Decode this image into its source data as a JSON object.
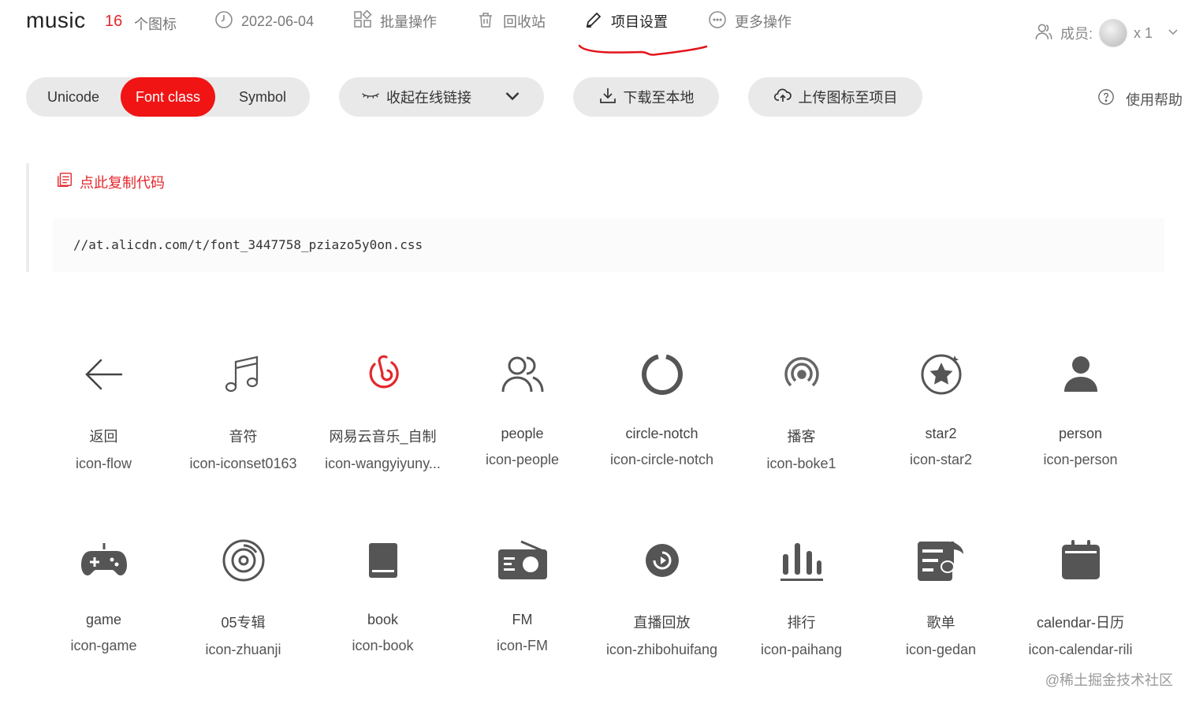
{
  "header": {
    "project_name": "music",
    "icon_count": "16",
    "icon_count_label": "个图标",
    "date": "2022-06-04",
    "batch_ops": "批量操作",
    "recycle_bin": "回收站",
    "project_settings": "项目设置",
    "more_ops": "更多操作",
    "members_label": "成员:",
    "members_count": "x 1",
    "accent_color": "#e4272c"
  },
  "toolbar": {
    "tabs": [
      "Unicode",
      "Font class",
      "Symbol"
    ],
    "active_tab": "Font class",
    "collapse_link": "收起在线链接",
    "download": "下载至本地",
    "upload": "上传图标至项目",
    "help": "使用帮助"
  },
  "code": {
    "copy_label": "点此复制代码",
    "url": "//at.alicdn.com/t/font_3447758_pziazo5y0on.css"
  },
  "icons": [
    {
      "title": "返回",
      "class_name": "icon-flow",
      "icon": "arrow-left-icon"
    },
    {
      "title": "音符",
      "class_name": "icon-iconset0163",
      "icon": "music-note-icon"
    },
    {
      "title": "网易云音乐_自制",
      "class_name": "icon-wangyiyuny...",
      "icon": "netease-music-icon"
    },
    {
      "title": "people",
      "class_name": "icon-people",
      "icon": "people-icon"
    },
    {
      "title": "circle-notch",
      "class_name": "icon-circle-notch",
      "icon": "circle-notch-icon"
    },
    {
      "title": "播客",
      "class_name": "icon-boke1",
      "icon": "podcast-icon"
    },
    {
      "title": "star2",
      "class_name": "icon-star2",
      "icon": "star-circle-icon"
    },
    {
      "title": "person",
      "class_name": "icon-person",
      "icon": "person-icon"
    },
    {
      "title": "game",
      "class_name": "icon-game",
      "icon": "gamepad-icon"
    },
    {
      "title": "05专辑",
      "class_name": "icon-zhuanji",
      "icon": "album-disc-icon"
    },
    {
      "title": "book",
      "class_name": "icon-book",
      "icon": "book-icon"
    },
    {
      "title": "FM",
      "class_name": "icon-FM",
      "icon": "radio-icon"
    },
    {
      "title": "直播回放",
      "class_name": "icon-zhibohuifang",
      "icon": "replay-icon"
    },
    {
      "title": "排行",
      "class_name": "icon-paihang",
      "icon": "ranking-bars-icon"
    },
    {
      "title": "歌单",
      "class_name": "icon-gedan",
      "icon": "playlist-icon"
    },
    {
      "title": "calendar-日历",
      "class_name": "icon-calendar-rili",
      "icon": "calendar-icon"
    }
  ],
  "watermark": "@稀土掘金技术社区"
}
